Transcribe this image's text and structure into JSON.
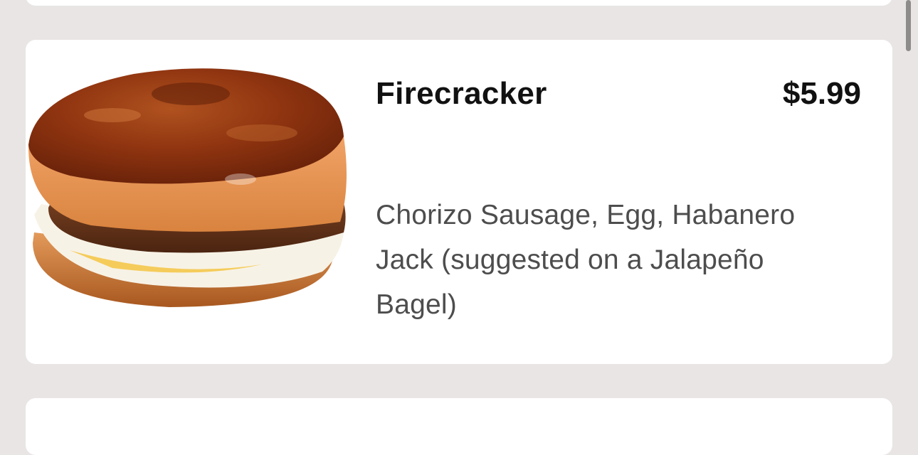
{
  "menu_item": {
    "name": "Firecracker",
    "price": "$5.99",
    "description": "Chorizo Sausage, Egg, Habanero Jack (suggested on a Jalapeño Bagel)",
    "image_icon": "breakfast-bagel-sandwich"
  },
  "colors": {
    "background": "#e8e5e4",
    "card": "#ffffff",
    "title_text": "#111111",
    "body_text": "#4d4d4d"
  }
}
